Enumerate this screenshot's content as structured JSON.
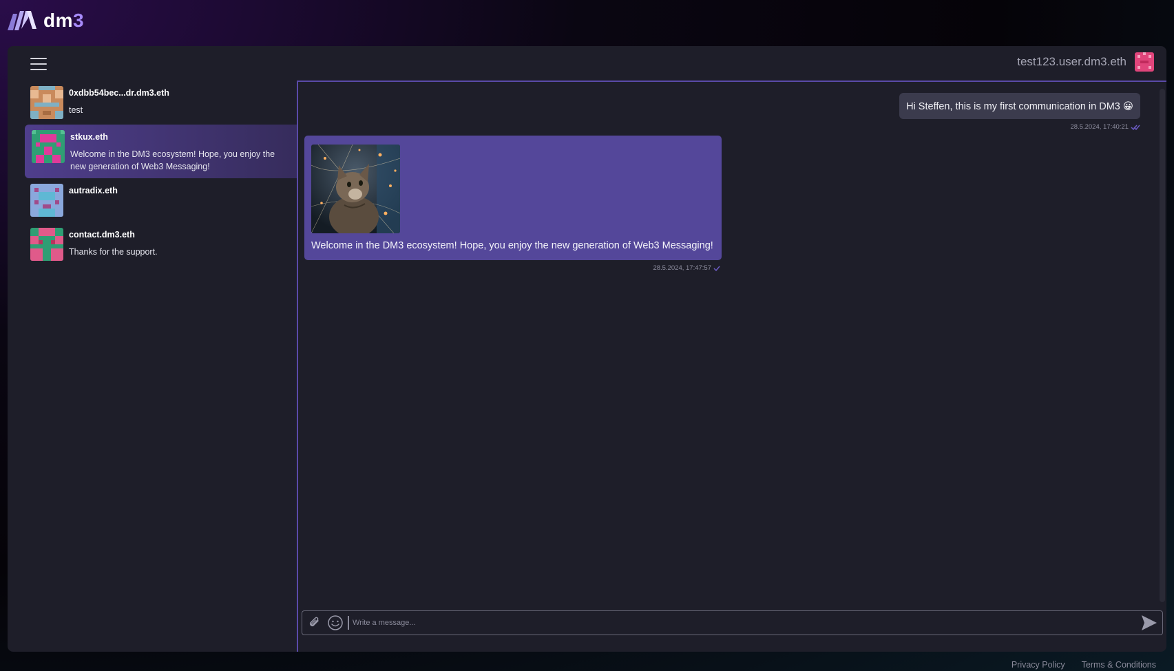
{
  "brand": {
    "name": "dm",
    "suffix": "3"
  },
  "header": {
    "account_name": "test123.user.dm3.eth"
  },
  "sidebar": {
    "contacts": [
      {
        "name": "0xdbb54bec...dr.dm3.eth",
        "preview": "test",
        "selected": false
      },
      {
        "name": "stkux.eth",
        "preview": "Welcome in the DM3 ecosystem! Hope, you enjoy the new generation of Web3 Messaging!",
        "selected": true
      },
      {
        "name": "autradix.eth",
        "preview": "",
        "selected": false
      },
      {
        "name": "contact.dm3.eth",
        "preview": "Thanks for the support.",
        "selected": false
      }
    ]
  },
  "chat": {
    "messages": [
      {
        "direction": "outgoing",
        "text": "Hi Steffen, this is my first communication in DM3 😀",
        "timestamp": "28.5.2024, 17:40:21",
        "status": "read"
      },
      {
        "direction": "incoming",
        "text": "Welcome in the DM3 ecosystem! Hope, you enjoy the new generation of Web3 Messaging!",
        "timestamp": "28.5.2024, 17:47:57",
        "status": "sent",
        "attachment": "kitten-image"
      }
    ]
  },
  "composer": {
    "placeholder": "Write a message..."
  },
  "footer": {
    "privacy": "Privacy Policy",
    "terms": "Terms & Conditions"
  },
  "colors": {
    "accent": "#5a4aa8",
    "incoming_bubble": "#54479a",
    "outgoing_bubble": "#3b3b4d",
    "panel": "#1e1e29"
  }
}
